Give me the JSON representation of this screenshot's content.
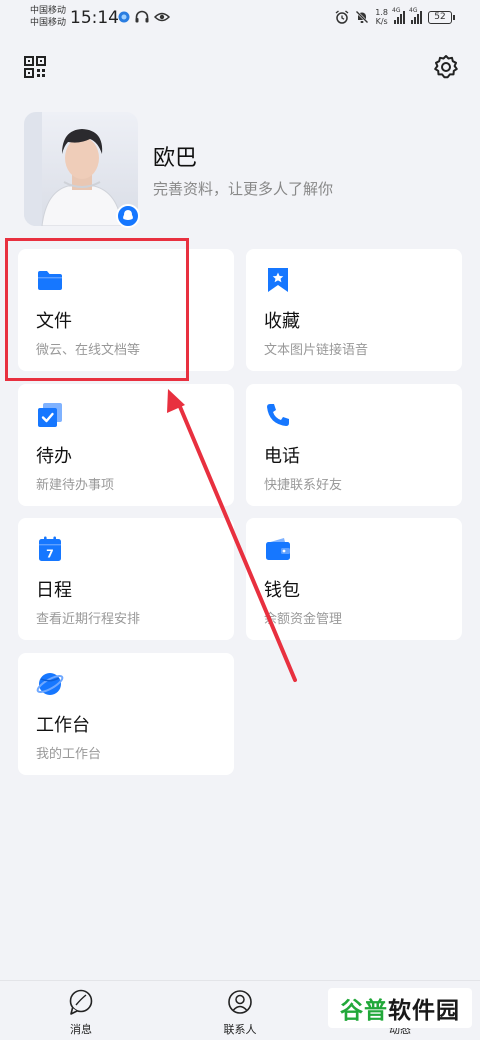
{
  "status_bar": {
    "carrier_1": "中国移动",
    "carrier_2": "中国移动",
    "time": "15:14",
    "net_speed_value": "1.8",
    "net_speed_unit": "K/s",
    "signal_1_type": "4G",
    "signal_2_type": "4G",
    "battery": "52"
  },
  "profile": {
    "name": "欧巴",
    "subtitle": "完善资料，让更多人了解你"
  },
  "cards": [
    {
      "id": "files",
      "title": "文件",
      "subtitle": "微云、在线文档等",
      "icon": "folder-icon"
    },
    {
      "id": "favorites",
      "title": "收藏",
      "subtitle": "文本图片链接语音",
      "icon": "bookmark-star-icon"
    },
    {
      "id": "todo",
      "title": "待办",
      "subtitle": "新建待办事项",
      "icon": "todo-check-icon"
    },
    {
      "id": "phone",
      "title": "电话",
      "subtitle": "快捷联系好友",
      "icon": "phone-icon"
    },
    {
      "id": "schedule",
      "title": "日程",
      "subtitle": "查看近期行程安排",
      "icon": "calendar-icon"
    },
    {
      "id": "wallet",
      "title": "钱包",
      "subtitle": "余额资金管理",
      "icon": "wallet-icon"
    },
    {
      "id": "workbench",
      "title": "工作台",
      "subtitle": "我的工作台",
      "icon": "planet-icon"
    }
  ],
  "calendar_day": "7",
  "bottom_nav": [
    {
      "label": "消息",
      "icon": "message-icon"
    },
    {
      "label": "联系人",
      "icon": "contacts-icon"
    },
    {
      "label": "动态",
      "icon": "star-icon"
    }
  ],
  "watermark": {
    "part_a": "谷普",
    "part_b": "软件园"
  },
  "colors": {
    "accent": "#1677ff",
    "annotation_red": "#e8303f",
    "background": "#f2f3f7"
  }
}
